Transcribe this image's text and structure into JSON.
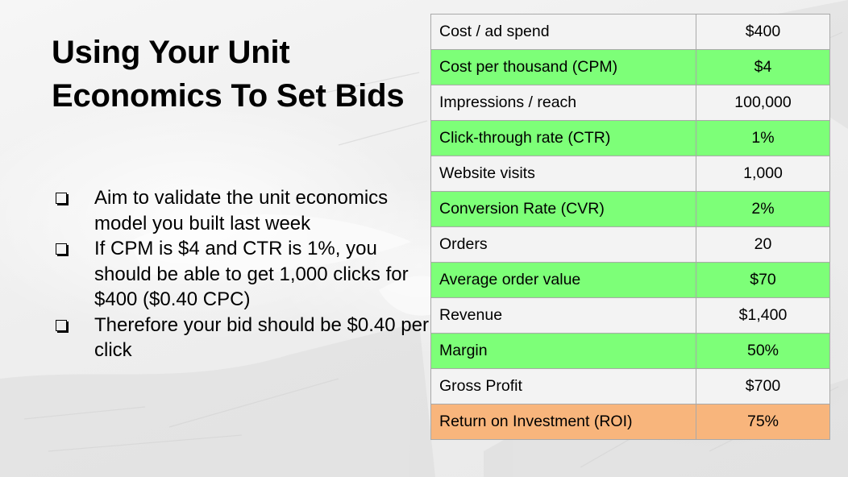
{
  "slide": {
    "title": "Using Your Unit Economics To Set Bids",
    "bullets": [
      "Aim to validate the unit economics model you built last week",
      "If CPM is $4 and CTR is 1%, you should be able to get 1,000 clicks for $400 ($0.40 CPC)",
      "Therefore your bid should be $0.40 per click"
    ]
  },
  "table": {
    "rows": [
      {
        "label": "Cost / ad spend",
        "value": "$400",
        "highlight": "none"
      },
      {
        "label": "Cost per thousand (CPM)",
        "value": "$4",
        "highlight": "green"
      },
      {
        "label": "Impressions / reach",
        "value": "100,000",
        "highlight": "none"
      },
      {
        "label": "Click-through rate (CTR)",
        "value": "1%",
        "highlight": "green"
      },
      {
        "label": "Website visits",
        "value": "1,000",
        "highlight": "none"
      },
      {
        "label": "Conversion Rate (CVR)",
        "value": "2%",
        "highlight": "green"
      },
      {
        "label": "Orders",
        "value": "20",
        "highlight": "none"
      },
      {
        "label": "Average order value",
        "value": "$70",
        "highlight": "green"
      },
      {
        "label": "Revenue",
        "value": "$1,400",
        "highlight": "none"
      },
      {
        "label": "Margin",
        "value": "50%",
        "highlight": "green"
      },
      {
        "label": "Gross Profit",
        "value": "$700",
        "highlight": "none"
      },
      {
        "label": "Return on Investment (ROI)",
        "value": "75%",
        "highlight": "orange"
      }
    ]
  },
  "colors": {
    "green_highlight": "#7dff78",
    "orange_highlight": "#f8b57c",
    "plain_cell": "#f3f3f3",
    "border": "#a9a9a9"
  },
  "icons": {
    "bullet": "checkbox-bullet-icon"
  }
}
